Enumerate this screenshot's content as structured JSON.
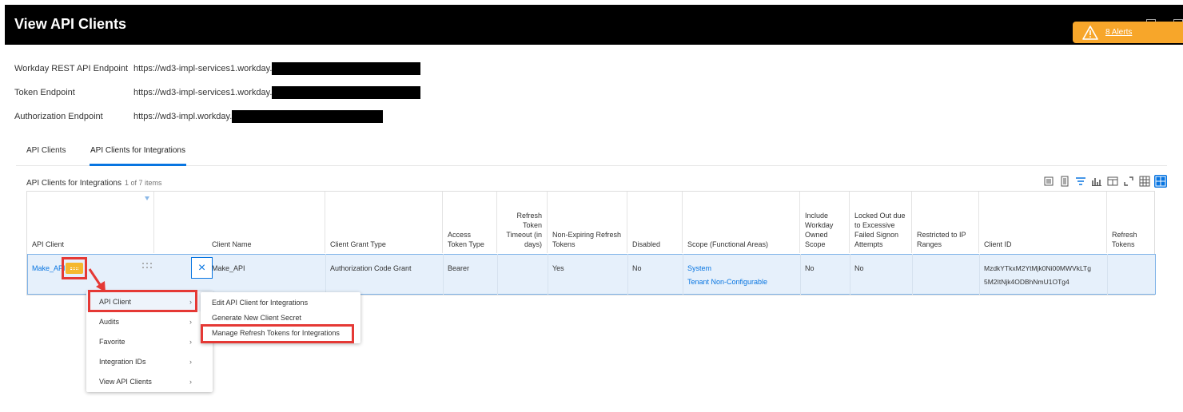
{
  "header": {
    "title": "View API Clients",
    "alerts_label": "8 Alerts"
  },
  "endpoints": [
    {
      "label": "Workday REST API Endpoint",
      "value": "https://wd3-impl-services1.workday."
    },
    {
      "label": "Token Endpoint",
      "value": "https://wd3-impl-services1.workday."
    },
    {
      "label": "Authorization Endpoint",
      "value": "https://wd3-impl.workday."
    }
  ],
  "tabs": [
    {
      "label": "API Clients"
    },
    {
      "label": "API Clients for Integrations"
    }
  ],
  "grid": {
    "title": "API Clients for Integrations",
    "count": "1 of 7 items",
    "columns": [
      "API Client",
      "Client Name",
      "Client Grant Type",
      "Access Token Type",
      "Refresh Token Timeout (in days)",
      "Non-Expiring Refresh Tokens",
      "Disabled",
      "Scope (Functional Areas)",
      "Include Workday Owned Scope",
      "Locked Out due to Excessive Failed Signon Attempts",
      "Restricted to IP Ranges",
      "Client ID",
      "Refresh Tokens"
    ],
    "row": {
      "api_client": "Make_API",
      "client_name": "Make_API",
      "grant_type": "Authorization Code Grant",
      "token_type": "Bearer",
      "refresh_timeout": "",
      "non_expiring": "Yes",
      "disabled": "No",
      "scope_1": "System",
      "scope_2": "Tenant Non-Configurable",
      "include_owned": "No",
      "locked_out": "No",
      "restricted_ip": "",
      "client_id_1": "MzdkYTkxM2YtMjk0Ni00MWVkLTg",
      "client_id_2": "5M2ItNjk4ODBhNmU1OTg4",
      "refresh_tokens": ""
    }
  },
  "menu": {
    "items": [
      {
        "label": "API Client"
      },
      {
        "label": "Audits"
      },
      {
        "label": "Favorite"
      },
      {
        "label": "Integration IDs"
      },
      {
        "label": "View API Clients"
      }
    ]
  },
  "submenu": {
    "items": [
      {
        "label": "Edit API Client for Integrations"
      },
      {
        "label": "Generate New Client Secret"
      },
      {
        "label": "Manage Refresh Tokens for Integrations"
      }
    ]
  },
  "colors": {
    "accent": "#0875e1",
    "alert": "#f7a62a",
    "highlight": "#e53935",
    "row_selected": "#e6f0fb"
  }
}
